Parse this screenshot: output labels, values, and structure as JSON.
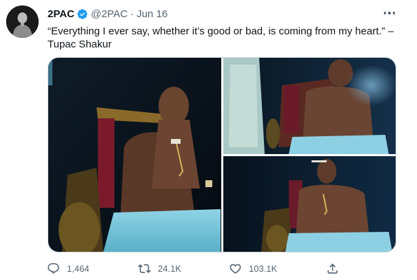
{
  "author": {
    "name": "2PAC",
    "handle": "@2PAC",
    "separator": "·",
    "date": "Jun 16"
  },
  "tweet": {
    "text_line1": "“Everything I ever say, whether it’s good or bad, is coming from my heart.” –",
    "text_line2": "Tupac Shakur"
  },
  "media": {
    "images": [
      {
        "icon": "photo-throne-portrait"
      },
      {
        "icon": "photo-smoking-closeup"
      },
      {
        "icon": "photo-throne-seated"
      }
    ]
  },
  "actions": {
    "reply_count": "1,464",
    "retweet_count": "24.1K",
    "like_count": "103.1K"
  },
  "colors": {
    "verified": "#1d9bf0",
    "icon_gray": "#536471",
    "border": "#cfd9de"
  }
}
